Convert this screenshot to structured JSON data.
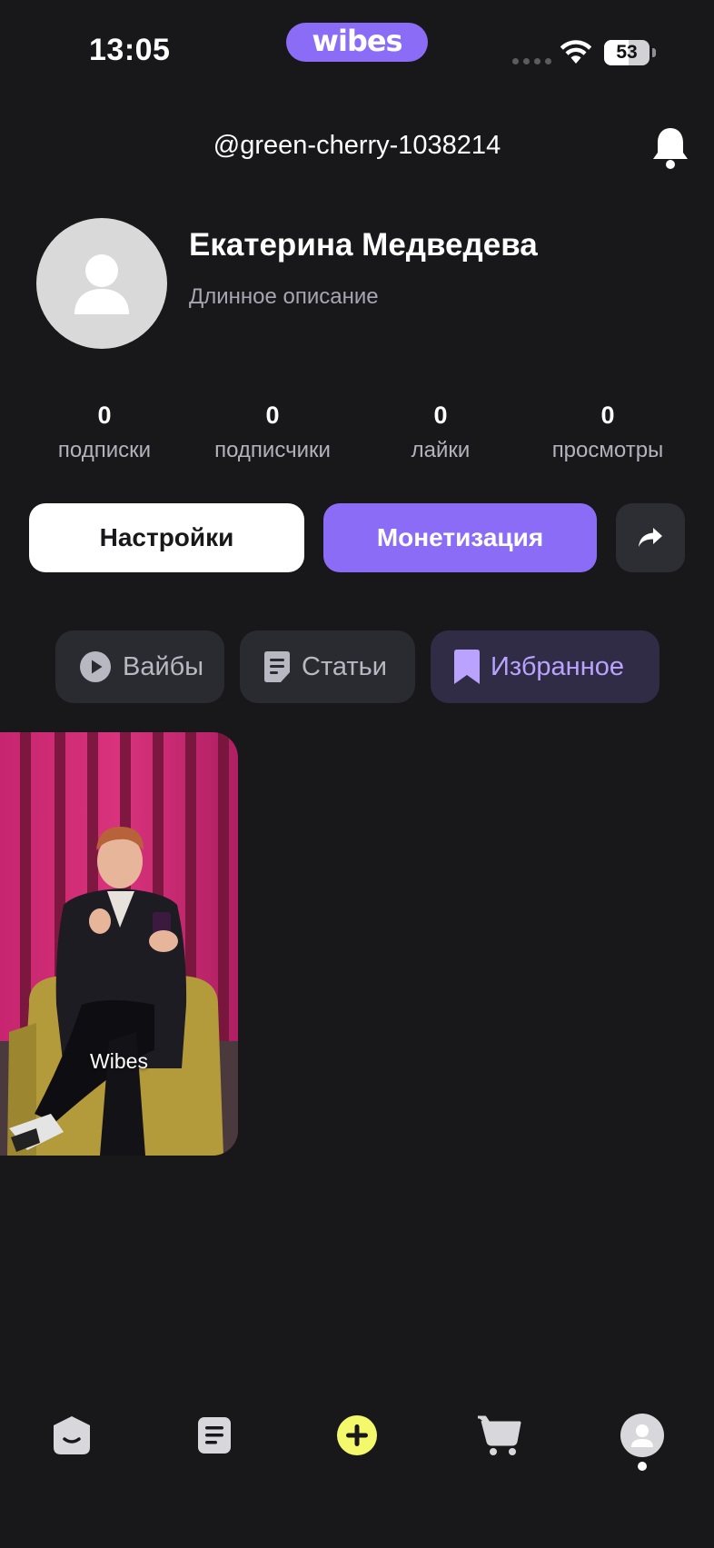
{
  "status_bar": {
    "time": "13:05",
    "brand": "wibes",
    "battery": "53",
    "battery_level": 0.53
  },
  "header": {
    "username": "@green-cherry-1038214",
    "bell_icon": "bell-icon"
  },
  "profile": {
    "name": "Екатерина Медведева",
    "description": "Длинное описание",
    "avatar_icon": "user-placeholder-icon"
  },
  "stats": [
    {
      "value": "0",
      "label": "подписки"
    },
    {
      "value": "0",
      "label": "подписчики"
    },
    {
      "value": "0",
      "label": "лайки"
    },
    {
      "value": "0",
      "label": "просмотры"
    }
  ],
  "actions": {
    "settings_label": "Настройки",
    "monetization_label": "Монетизация",
    "share_icon": "share-arrow-icon"
  },
  "tabs": [
    {
      "label": "Вайбы",
      "icon": "play-circle-icon"
    },
    {
      "label": "Статьи",
      "icon": "article-icon"
    },
    {
      "label": "Избранное",
      "icon": "bookmark-icon",
      "active": true
    }
  ],
  "videos": [
    {
      "caption": "Wibes"
    }
  ],
  "bottom_nav": [
    {
      "name": "vibes-feed",
      "icon": "face-icon"
    },
    {
      "name": "articles",
      "icon": "document-icon"
    },
    {
      "name": "create",
      "icon": "plus-circle-icon"
    },
    {
      "name": "shop",
      "icon": "cart-icon"
    },
    {
      "name": "profile",
      "icon": "profile-avatar-icon",
      "active": true
    }
  ],
  "colors": {
    "background": "#18181b",
    "accent": "#8b6cf6",
    "create_button": "#f4f96b",
    "tab_active_text": "#b9a3ff"
  }
}
